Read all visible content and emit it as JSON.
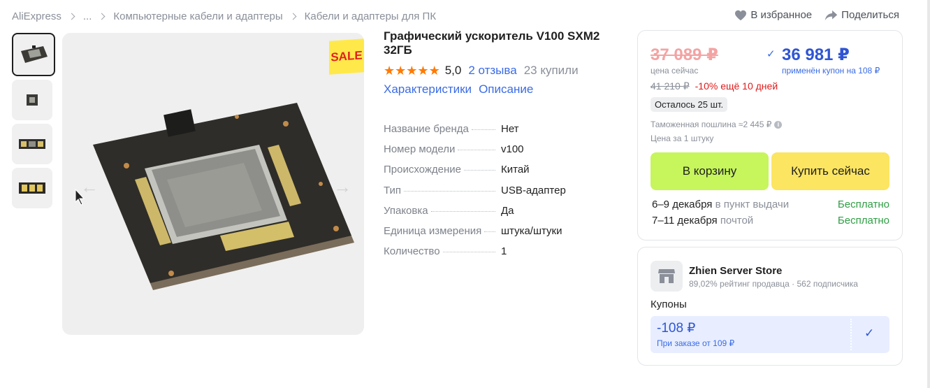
{
  "breadcrumb": [
    "AliExpress",
    "...",
    "Компьютерные кабели и адаптеры",
    "Кабели и адаптеры для ПК"
  ],
  "actions": {
    "favorite": "В избранное",
    "share": "Поделиться"
  },
  "gallery": {
    "sale_badge": "SALE",
    "thumbnail_count": 4
  },
  "product": {
    "title": "Графический ускоритель V100 SXM2 32ГБ",
    "rating": "5,0",
    "stars": 5,
    "reviews": "2 отзыва",
    "sold": "23 купили",
    "links": [
      "Характеристики",
      "Описание"
    ],
    "specs": [
      {
        "name": "Название бренда",
        "value": "Нет"
      },
      {
        "name": "Номер модели",
        "value": "v100"
      },
      {
        "name": "Происхождение",
        "value": "Китай"
      },
      {
        "name": "Тип",
        "value": "USB-адаптер"
      },
      {
        "name": "Упаковка",
        "value": "Да"
      },
      {
        "name": "Единица измерения",
        "value": "штука/штуки"
      },
      {
        "name": "Количество",
        "value": "1"
      }
    ]
  },
  "price": {
    "old": "37 089 ₽",
    "now_label": "цена сейчас",
    "new": "36 981 ₽",
    "coupon_applied": "применён купон на 108 ₽",
    "original": "41 210 ₽",
    "discount": "-10% ещё 10 дней",
    "stock": "Осталось 25 шт.",
    "duty": "Таможенная пошлина ≈2 445 ₽",
    "per_unit": "Цена за 1 штуку",
    "cart_button": "В корзину",
    "buy_button": "Купить сейчас"
  },
  "shipping": [
    {
      "dates": "6–9 декабря",
      "method": "в пункт выдачи",
      "cost": "Бесплатно"
    },
    {
      "dates": "7–11 декабря",
      "method": "почтой",
      "cost": "Бесплатно"
    }
  ],
  "store": {
    "name": "Zhien Server Store",
    "rating": "89,02% рейтинг продавца",
    "subscribers": "562 подписчика",
    "coupons_label": "Купоны",
    "coupon": {
      "amount": "-108 ₽",
      "condition": "При заказе от 109 ₽"
    }
  },
  "colors": {
    "accent_blue": "#2f55d4",
    "cart_green": "#c6f55c",
    "buy_yellow": "#fbe561",
    "star_orange": "#ff7a00",
    "discount_red": "#e01a1a"
  }
}
